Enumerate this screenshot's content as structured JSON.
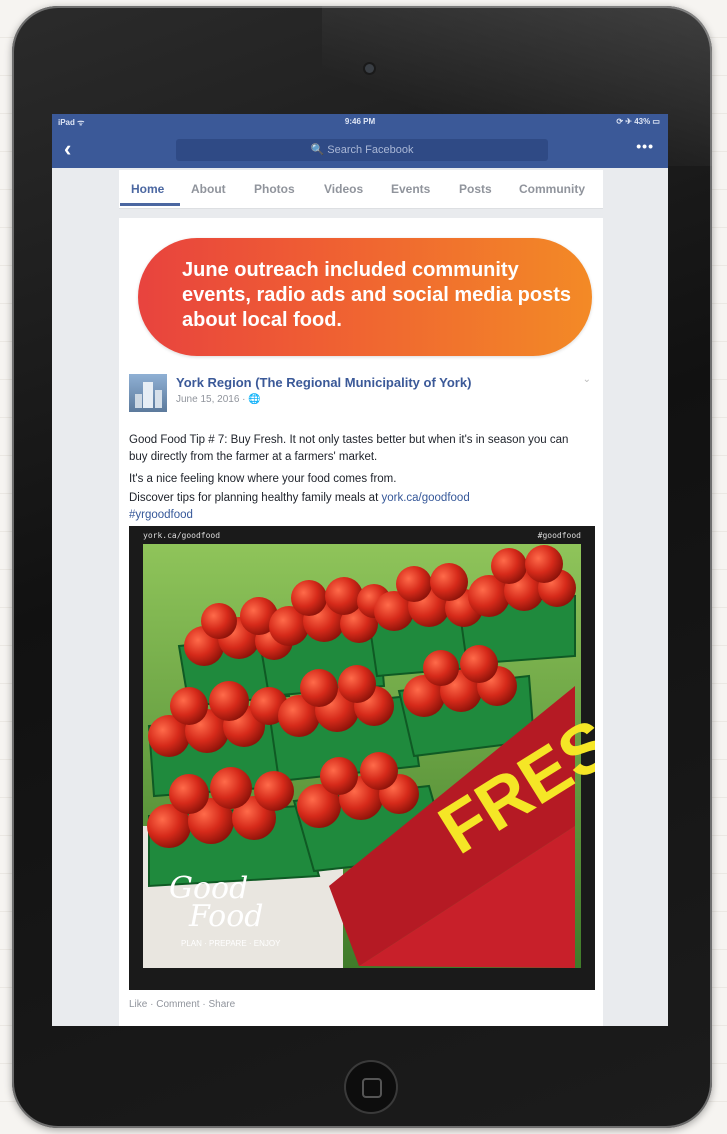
{
  "status_bar": {
    "left": "iPad ᯤ",
    "time": "9:46 PM",
    "right": "⟳ ✈ 43% ▭"
  },
  "nav": {
    "back_icon": "chevron-left-icon",
    "search_placeholder": "🔍 Search Facebook",
    "more_label": "•••"
  },
  "tabs": [
    {
      "label": "Home",
      "active": true
    },
    {
      "label": "About"
    },
    {
      "label": "Photos"
    },
    {
      "label": "Videos"
    },
    {
      "label": "Events"
    },
    {
      "label": "Posts"
    },
    {
      "label": "Community"
    }
  ],
  "banner": {
    "text": "June outreach included community events, radio ads and social media posts about local food.",
    "colors": [
      "#e8433e",
      "#f38a26"
    ]
  },
  "post": {
    "page_name": "York Region (The Regional Municipality of York)",
    "date": "June 15, 2016 · 🌐",
    "paragraph1": "Good Food Tip # 7: Buy Fresh. It not only tastes better but when it's in season you can buy directly from the farmer at a farmers' market.",
    "paragraph2": "It's a nice feeling know where your food comes from.",
    "paragraph3_prefix": "Discover tips for planning healthy family meals at ",
    "paragraph3_link": "york.ca/goodfood",
    "hashtag": "#yrgoodfood",
    "photo": {
      "caption_left": "york.ca/goodfood",
      "caption_right": "#goodfood",
      "sign_text": "FRESH",
      "logo_line1": "Good",
      "logo_line2": "Food",
      "logo_tagline": "PLAN · PREPARE · ENJOY"
    },
    "actions": "Like · Comment · Share"
  },
  "colors": {
    "facebook_blue": "#3b5998",
    "tab_active": "#4b67a1",
    "link": "#365899",
    "sign_red": "#c8202a",
    "sign_yellow": "#f5e626"
  }
}
